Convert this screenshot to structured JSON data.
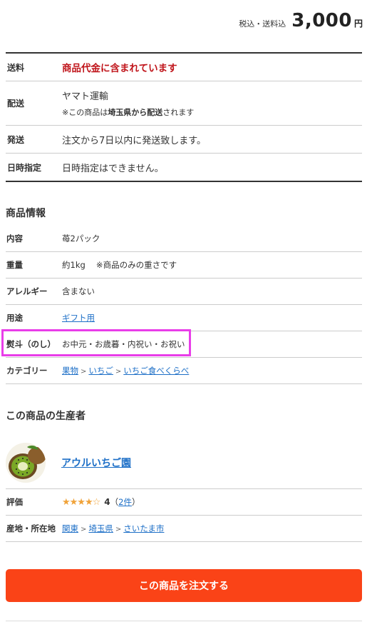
{
  "price": {
    "note": "税込・送料込",
    "amount": "3,000",
    "unit": "円"
  },
  "shipping": [
    {
      "label": "送料",
      "value": "商品代金に含まれています"
    },
    {
      "label": "配送",
      "value": "ヤマト運輸",
      "sub_prefix": "※この商品は",
      "sub_bold": "埼玉県から配送",
      "sub_suffix": "されます"
    },
    {
      "label": "発送",
      "value": "注文から7日以内に発送致します。"
    },
    {
      "label": "日時指定",
      "value": "日時指定はできません。"
    }
  ],
  "product_info": {
    "title": "商品情報",
    "rows": [
      {
        "label": "内容",
        "value": "苺2パック"
      },
      {
        "label": "重量",
        "value": "約1kg　 ※商品のみの重さです"
      },
      {
        "label": "アレルギー",
        "value": "含まない"
      },
      {
        "label": "用途",
        "value": "ギフト用"
      },
      {
        "label": "熨斗（のし）",
        "value": "お中元・お歳暮・内祝い・お祝い"
      },
      {
        "label": "カテゴリー",
        "links": [
          "果物",
          "いちご",
          "いちご食べくらべ"
        ],
        "separator": ">"
      }
    ]
  },
  "producer": {
    "title": "この商品の生産者",
    "name": "アウルいちご園",
    "avatar_icon": "kiwi-fruit-image",
    "rating_label": "評価",
    "stars": "★★★★☆",
    "rating": "4",
    "review_open": "（",
    "review_count": "2件",
    "review_close": "）",
    "location_label": "産地・所在地",
    "locations": [
      "関東",
      "埼玉県",
      "さいたま市"
    ],
    "separator": ">"
  },
  "order_button": "この商品を注文する",
  "colors": {
    "accent": "#fa4317",
    "highlight": "#e93de9",
    "link": "#1d6fc7",
    "alert": "#c0151b"
  }
}
